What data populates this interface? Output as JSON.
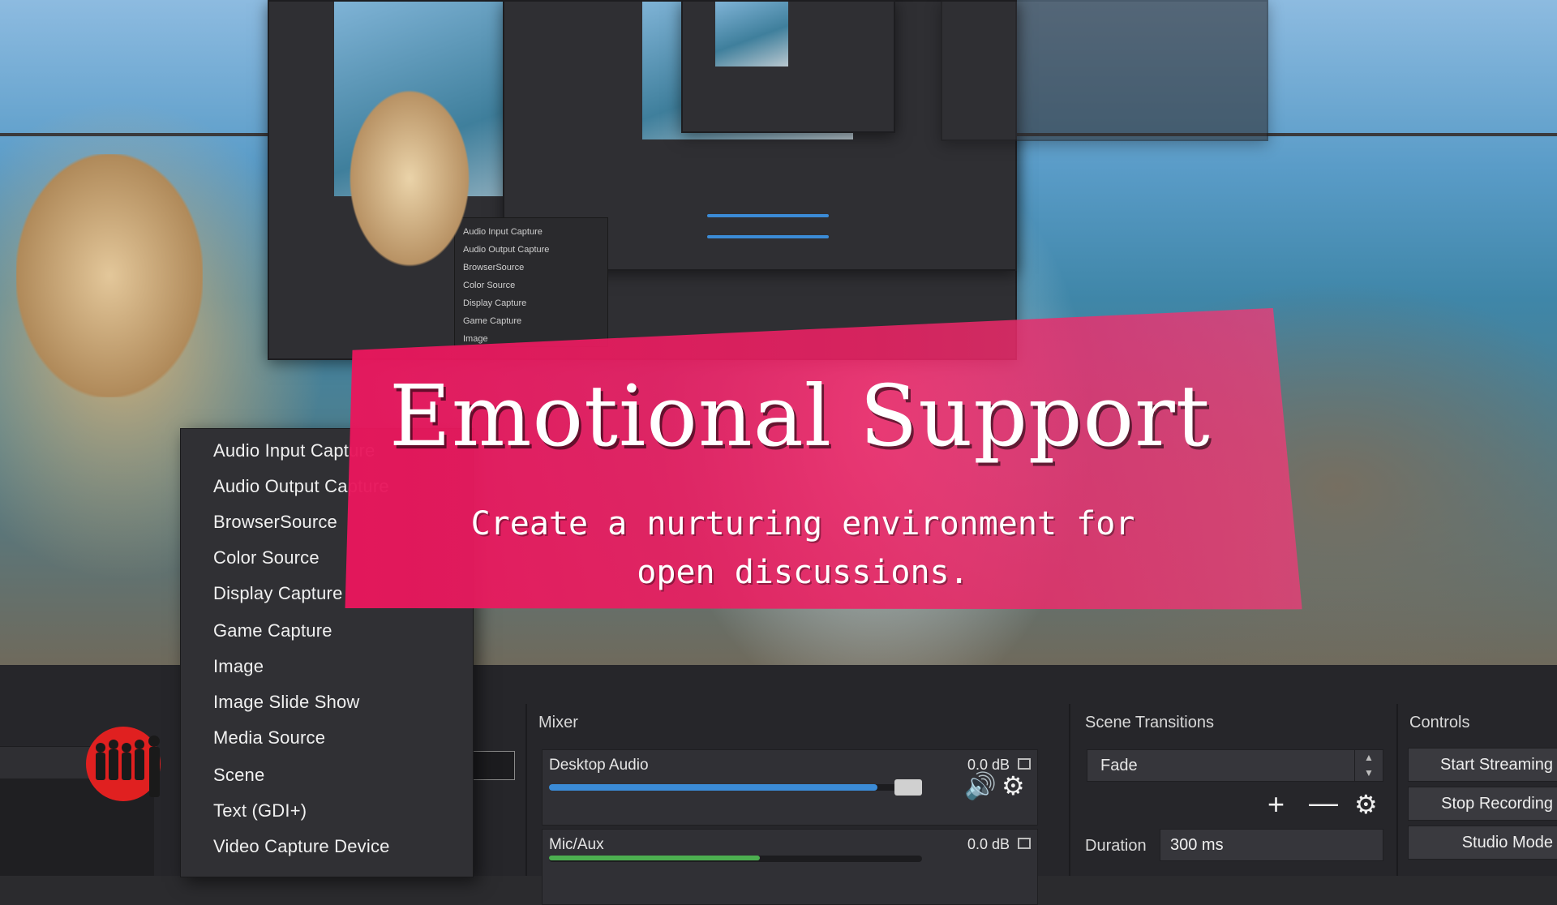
{
  "banner": {
    "title": "Emotional Support",
    "subtitle_line1": "Create a nurturing environment for",
    "subtitle_line2": "open discussions."
  },
  "context_menu": {
    "items": [
      "Audio Input Capture",
      "Audio Output Capture",
      "BrowserSource",
      "Color Source",
      "Display Capture",
      "Game Capture",
      "Image",
      "Image Slide Show",
      "Media Source",
      "Scene",
      "Text (GDI+)",
      "Video Capture Device"
    ]
  },
  "preview_mini_menu": {
    "items": [
      "Audio Input Capture",
      "Audio Output Capture",
      "BrowserSource",
      "Color Source",
      "Display Capture",
      "Game Capture",
      "Image"
    ]
  },
  "mixer": {
    "title": "Mixer",
    "channels": [
      {
        "name": "Desktop Audio",
        "level": "0.0 dB",
        "volume_fraction": 0.88,
        "meter_color": "#3b8bd6"
      },
      {
        "name": "Mic/Aux",
        "level": "0.0 dB",
        "volume_fraction": 0.5,
        "meter_color": "#4caf50"
      }
    ]
  },
  "scene_transitions": {
    "title": "Scene Transitions",
    "selected": "Fade",
    "duration_label": "Duration",
    "duration_value": "300 ms"
  },
  "controls": {
    "title": "Controls",
    "buttons": [
      "Start Streaming",
      "Stop Recording",
      "Studio Mode"
    ]
  },
  "colors": {
    "banner": "#e8165c",
    "accent_blue": "#3b8bd6",
    "accent_green": "#4caf50",
    "dock_bg": "#26262a"
  },
  "icons": [
    "speaker-icon",
    "gear-icon",
    "plus-icon",
    "minus-icon",
    "select-arrows-icon",
    "meter-icon",
    "logo"
  ]
}
